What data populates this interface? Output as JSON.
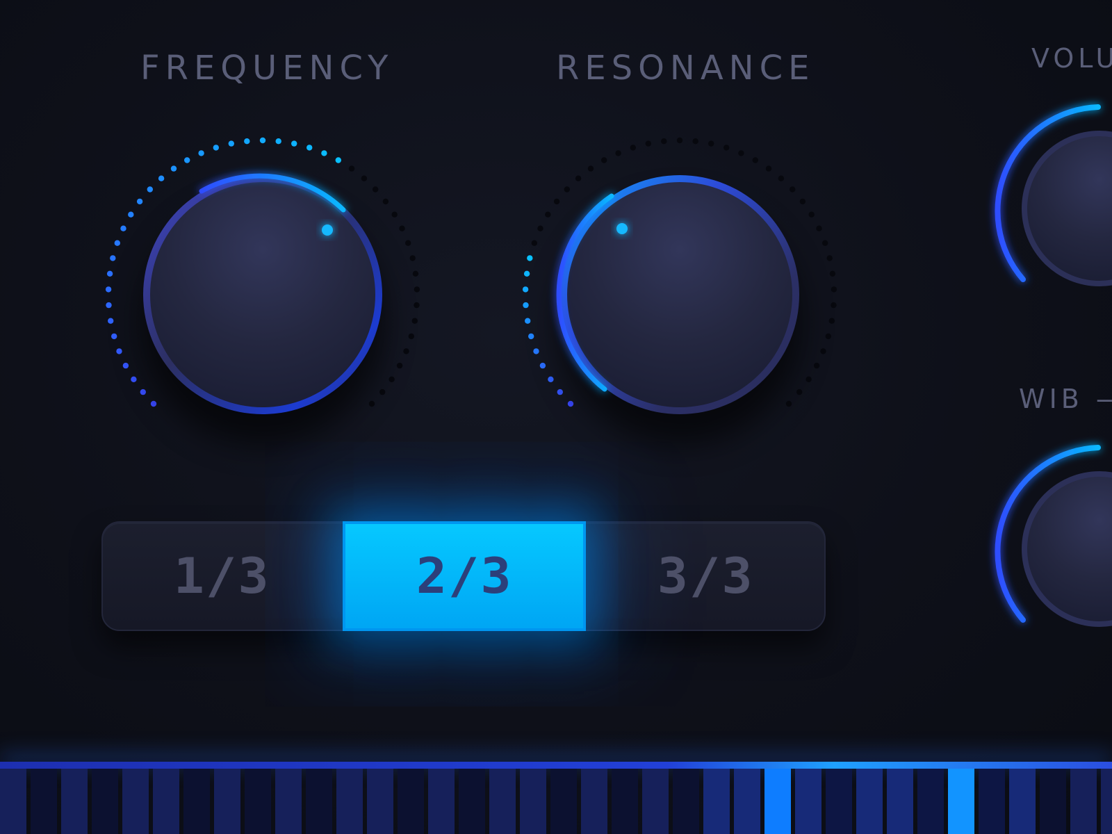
{
  "panel": {
    "frequency": {
      "label": "FREQUENCY",
      "level": 0.62
    },
    "resonance": {
      "label": "RESONANCE",
      "level": 0.22
    },
    "volume": {
      "label": "VOLU"
    },
    "wib": {
      "label": "WIB —"
    }
  },
  "page_toggle": {
    "options": [
      "1/3",
      "2/3",
      "3/3"
    ],
    "selected": "2/3"
  },
  "colors": {
    "background": "#0c0e16",
    "accent": "#00b4ff",
    "accent_deep": "#2b5cff",
    "knob": "#272a42",
    "label": "#5a5e78"
  },
  "icons": {
    "frequency_indicator": "dot-indicator-icon",
    "resonance_indicator": "dot-indicator-icon"
  }
}
